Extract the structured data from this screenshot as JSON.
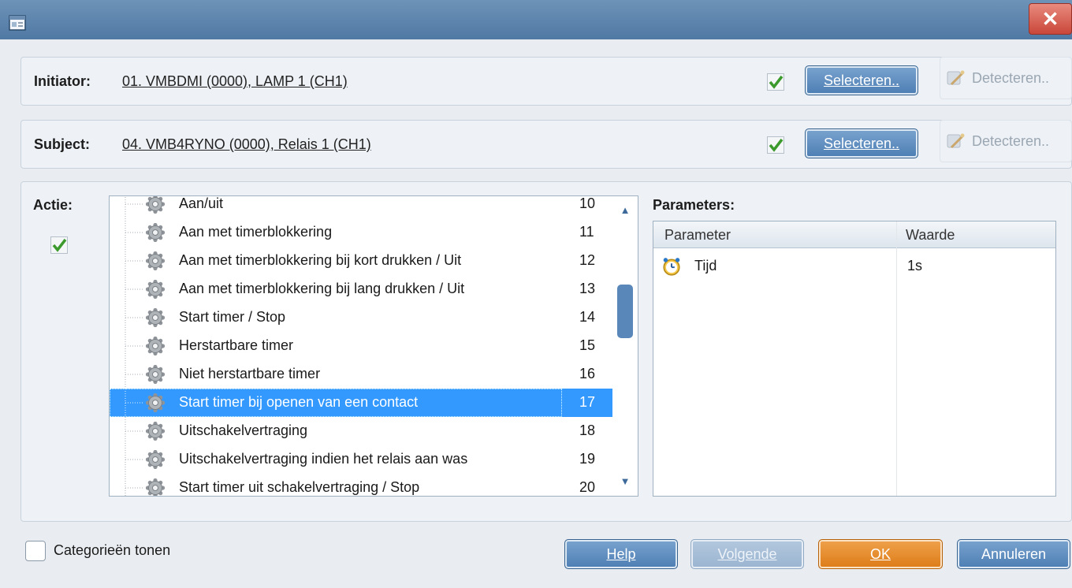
{
  "window": {
    "icon": "dialog-app-icon",
    "close_label": "✕"
  },
  "initiator": {
    "label": "Initiator:",
    "value": "01. VMBDMI (0000), LAMP 1 (CH1)",
    "select_label": "Selecteren..",
    "detect_label": "Detecteren.."
  },
  "subject": {
    "label": "Subject:",
    "value": "04. VMB4RYNO (0000), Relais 1 (CH1)",
    "select_label": "Selecteren..",
    "detect_label": "Detecteren.."
  },
  "action": {
    "label": "Actie:",
    "items": [
      {
        "label": "Aan/uit",
        "number": "10"
      },
      {
        "label": "Aan met timerblokkering",
        "number": "11"
      },
      {
        "label": "Aan met timerblokkering bij kort drukken / Uit",
        "number": "12"
      },
      {
        "label": "Aan met timerblokkering bij lang drukken / Uit",
        "number": "13"
      },
      {
        "label": "Start timer / Stop",
        "number": "14"
      },
      {
        "label": "Herstartbare timer",
        "number": "15"
      },
      {
        "label": "Niet herstartbare timer",
        "number": "16"
      },
      {
        "label": "Start timer bij openen van een contact",
        "number": "17"
      },
      {
        "label": "Uitschakelvertraging",
        "number": "18"
      },
      {
        "label": "Uitschakelvertraging indien het relais aan was",
        "number": "19"
      },
      {
        "label": "Start timer uit schakelvertraging / Stop",
        "number": "20"
      }
    ],
    "selected_index": 7
  },
  "parameters": {
    "label": "Parameters:",
    "columns": [
      "Parameter",
      "Waarde"
    ],
    "rows": [
      {
        "name": "Tijd",
        "value": "1s",
        "icon": "alarm-clock-icon"
      }
    ]
  },
  "footer": {
    "show_categories_label": "Categorieën tonen",
    "help_label": "Help",
    "next_label": "Volgende",
    "ok_label": "OK",
    "cancel_label": "Annuleren"
  },
  "colors": {
    "title_bar": "#5580ab",
    "selection": "#3399ff",
    "ok_button": "#e58a2c",
    "check": "#3c9a2c"
  }
}
